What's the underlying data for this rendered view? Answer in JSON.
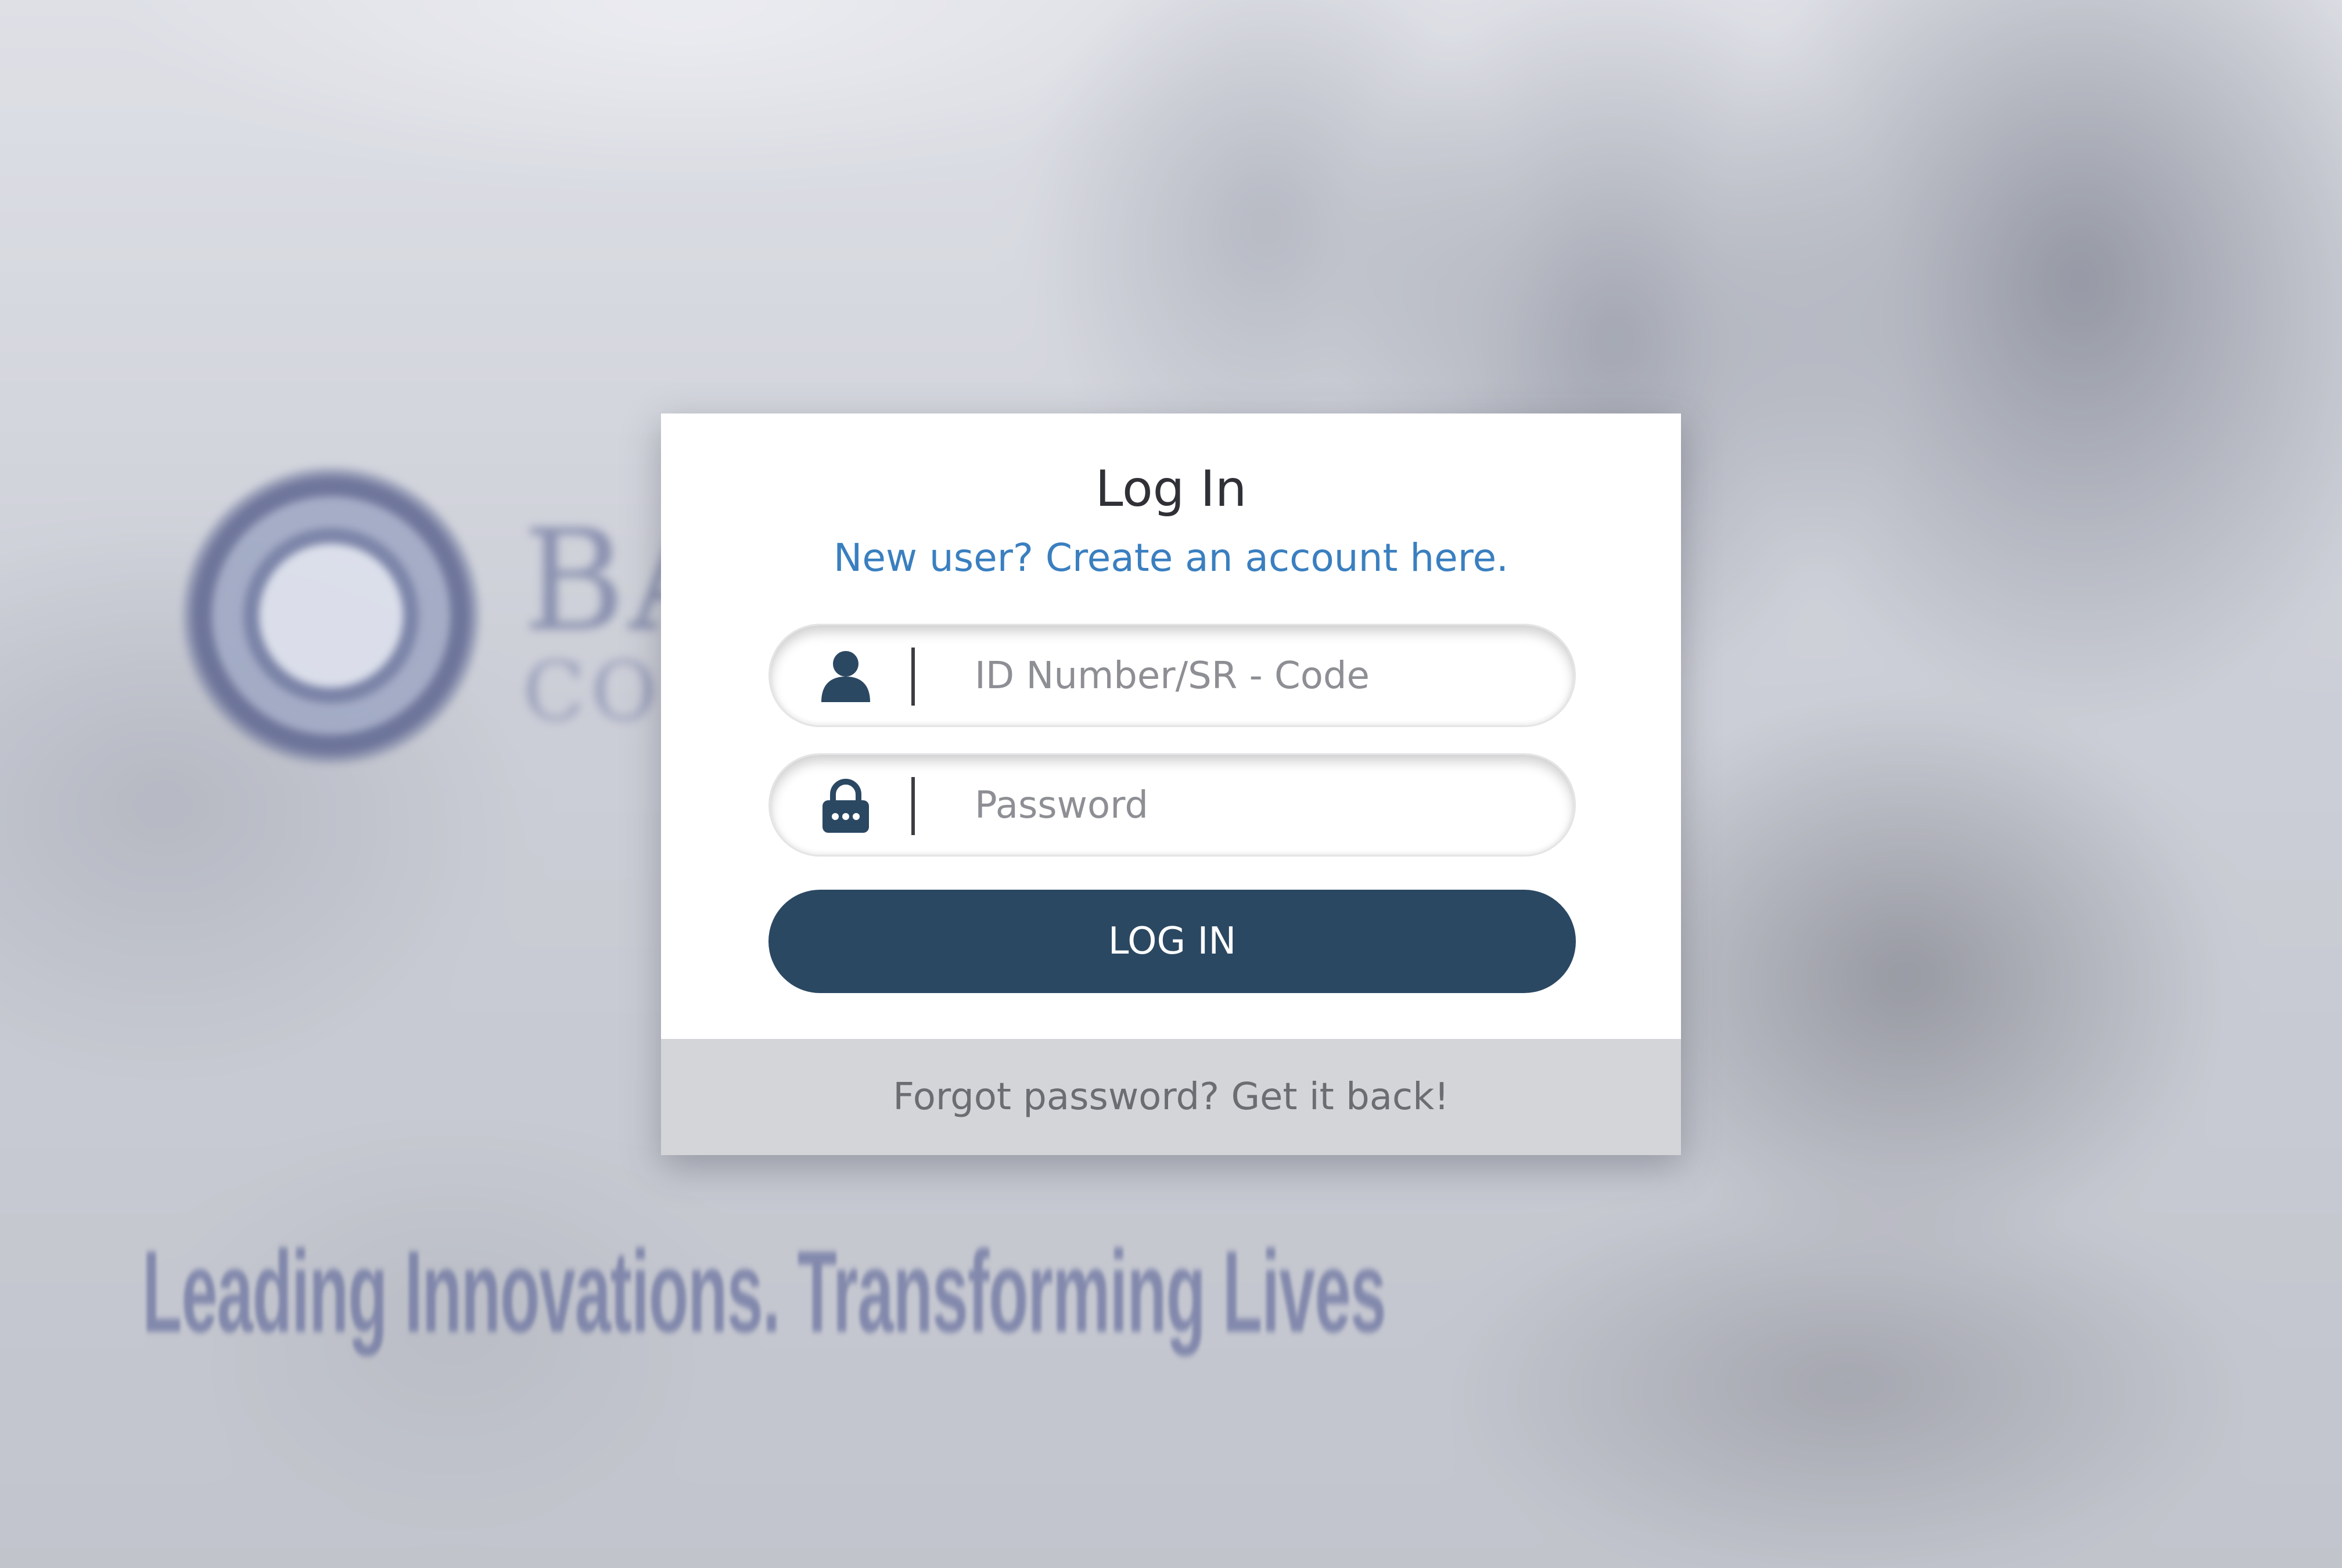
{
  "background": {
    "institution_name_partial": "BA",
    "institution_subtitle_partial": "CO",
    "tagline": "Leading Innovations. Transforming Lives"
  },
  "login": {
    "title": "Log In",
    "signup_link": "New user? Create an account here.",
    "id_field": {
      "placeholder": "ID Number/SR - Code",
      "icon": "user-icon"
    },
    "password_field": {
      "placeholder": "Password",
      "icon": "lock-icon"
    },
    "submit_label": "LOG IN",
    "forgot_link": "Forgot password? Get it back!"
  },
  "colors": {
    "button": "#2b4862",
    "link": "#3a7fc0",
    "footer_bg": "#d4d5d8"
  }
}
